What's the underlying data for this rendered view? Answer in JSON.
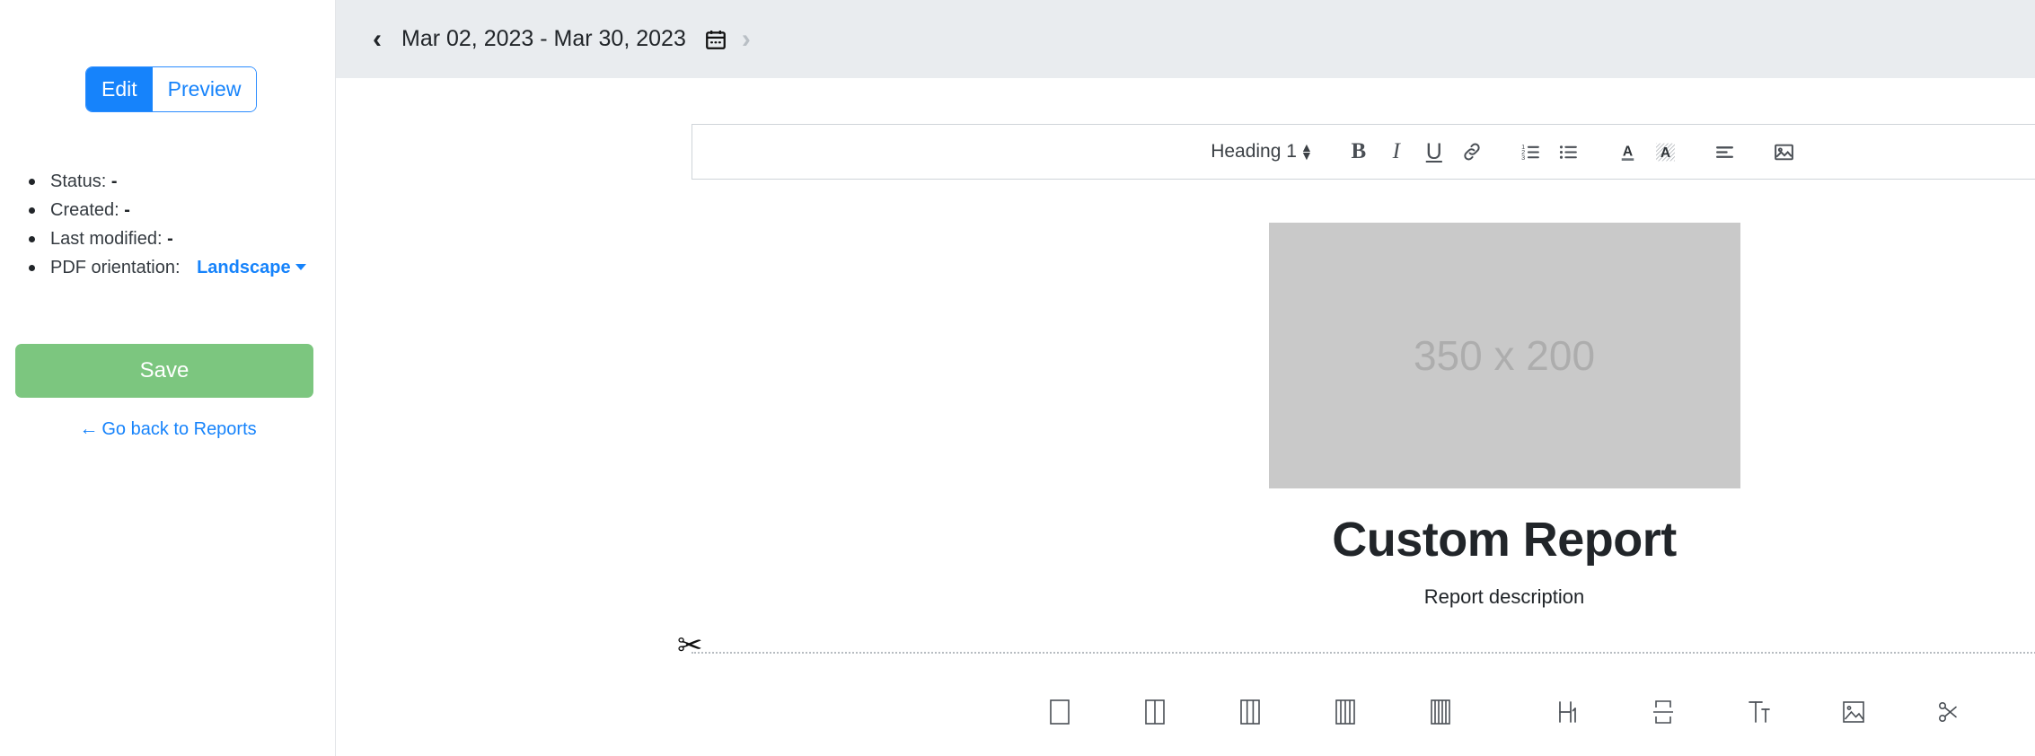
{
  "sidebar": {
    "mode_toggle": {
      "edit_label": "Edit",
      "preview_label": "Preview",
      "active": "Edit",
      "active_bg": "#1683fb",
      "inactive_text": "#1683fb"
    },
    "meta": [
      {
        "label": "Status:",
        "value": "-"
      },
      {
        "label": "Created:",
        "value": "-"
      },
      {
        "label": "Last modified:",
        "value": "-"
      }
    ],
    "orientation": {
      "label": "PDF orientation:",
      "value": "Landscape",
      "icon": "chevron-down-icon",
      "color": "#1683fb"
    },
    "save_label": "Save",
    "save_color": "#7cc67f",
    "go_back_label": "Go back to Reports",
    "go_back_arrow": "←",
    "go_back_color": "#1683fb"
  },
  "header": {
    "prev_icon": "chevron-left-icon",
    "next_icon": "chevron-right-icon",
    "next_disabled": true,
    "date_range": "Mar 02, 2023 - Mar 30, 2023",
    "calendar_icon": "calendar-icon",
    "background": "#e9ecef"
  },
  "editor_toolbar": {
    "heading_label": "Heading 1",
    "heading_icon": "updown-spinner-icon",
    "buttons": [
      {
        "name": "bold-icon",
        "label": "B"
      },
      {
        "name": "italic-icon",
        "label": "I"
      },
      {
        "name": "underline-icon",
        "label": "U"
      },
      {
        "name": "link-icon",
        "label": ""
      },
      {
        "name": "ordered-list-icon",
        "label": ""
      },
      {
        "name": "unordered-list-icon",
        "label": ""
      },
      {
        "name": "text-color-icon",
        "label": "A"
      },
      {
        "name": "highlight-color-icon",
        "label": "A"
      },
      {
        "name": "align-icon",
        "label": ""
      },
      {
        "name": "insert-image-icon",
        "label": ""
      }
    ]
  },
  "document": {
    "image_placeholder_text": "350 x 200",
    "image_placeholder_bg": "#c9c9c9",
    "title": "Custom Report",
    "description": "Report description"
  },
  "page_break": {
    "scissors_icon": "scissors-icon",
    "line_style": "dotted"
  },
  "insert_toolbar": {
    "buttons": [
      {
        "name": "layout-1-column-icon",
        "columns": 1
      },
      {
        "name": "layout-2-column-icon",
        "columns": 2
      },
      {
        "name": "layout-3-column-icon",
        "columns": 3
      },
      {
        "name": "layout-4-column-icon",
        "columns": 4
      },
      {
        "name": "layout-5-column-icon",
        "columns": 5
      },
      {
        "name": "insert-heading-icon",
        "label": "H1"
      },
      {
        "name": "insert-page-break-icon",
        "label": ""
      },
      {
        "name": "insert-text-icon",
        "label": "Tt"
      },
      {
        "name": "insert-image-icon",
        "label": ""
      },
      {
        "name": "insert-cut-icon",
        "label": ""
      }
    ]
  }
}
